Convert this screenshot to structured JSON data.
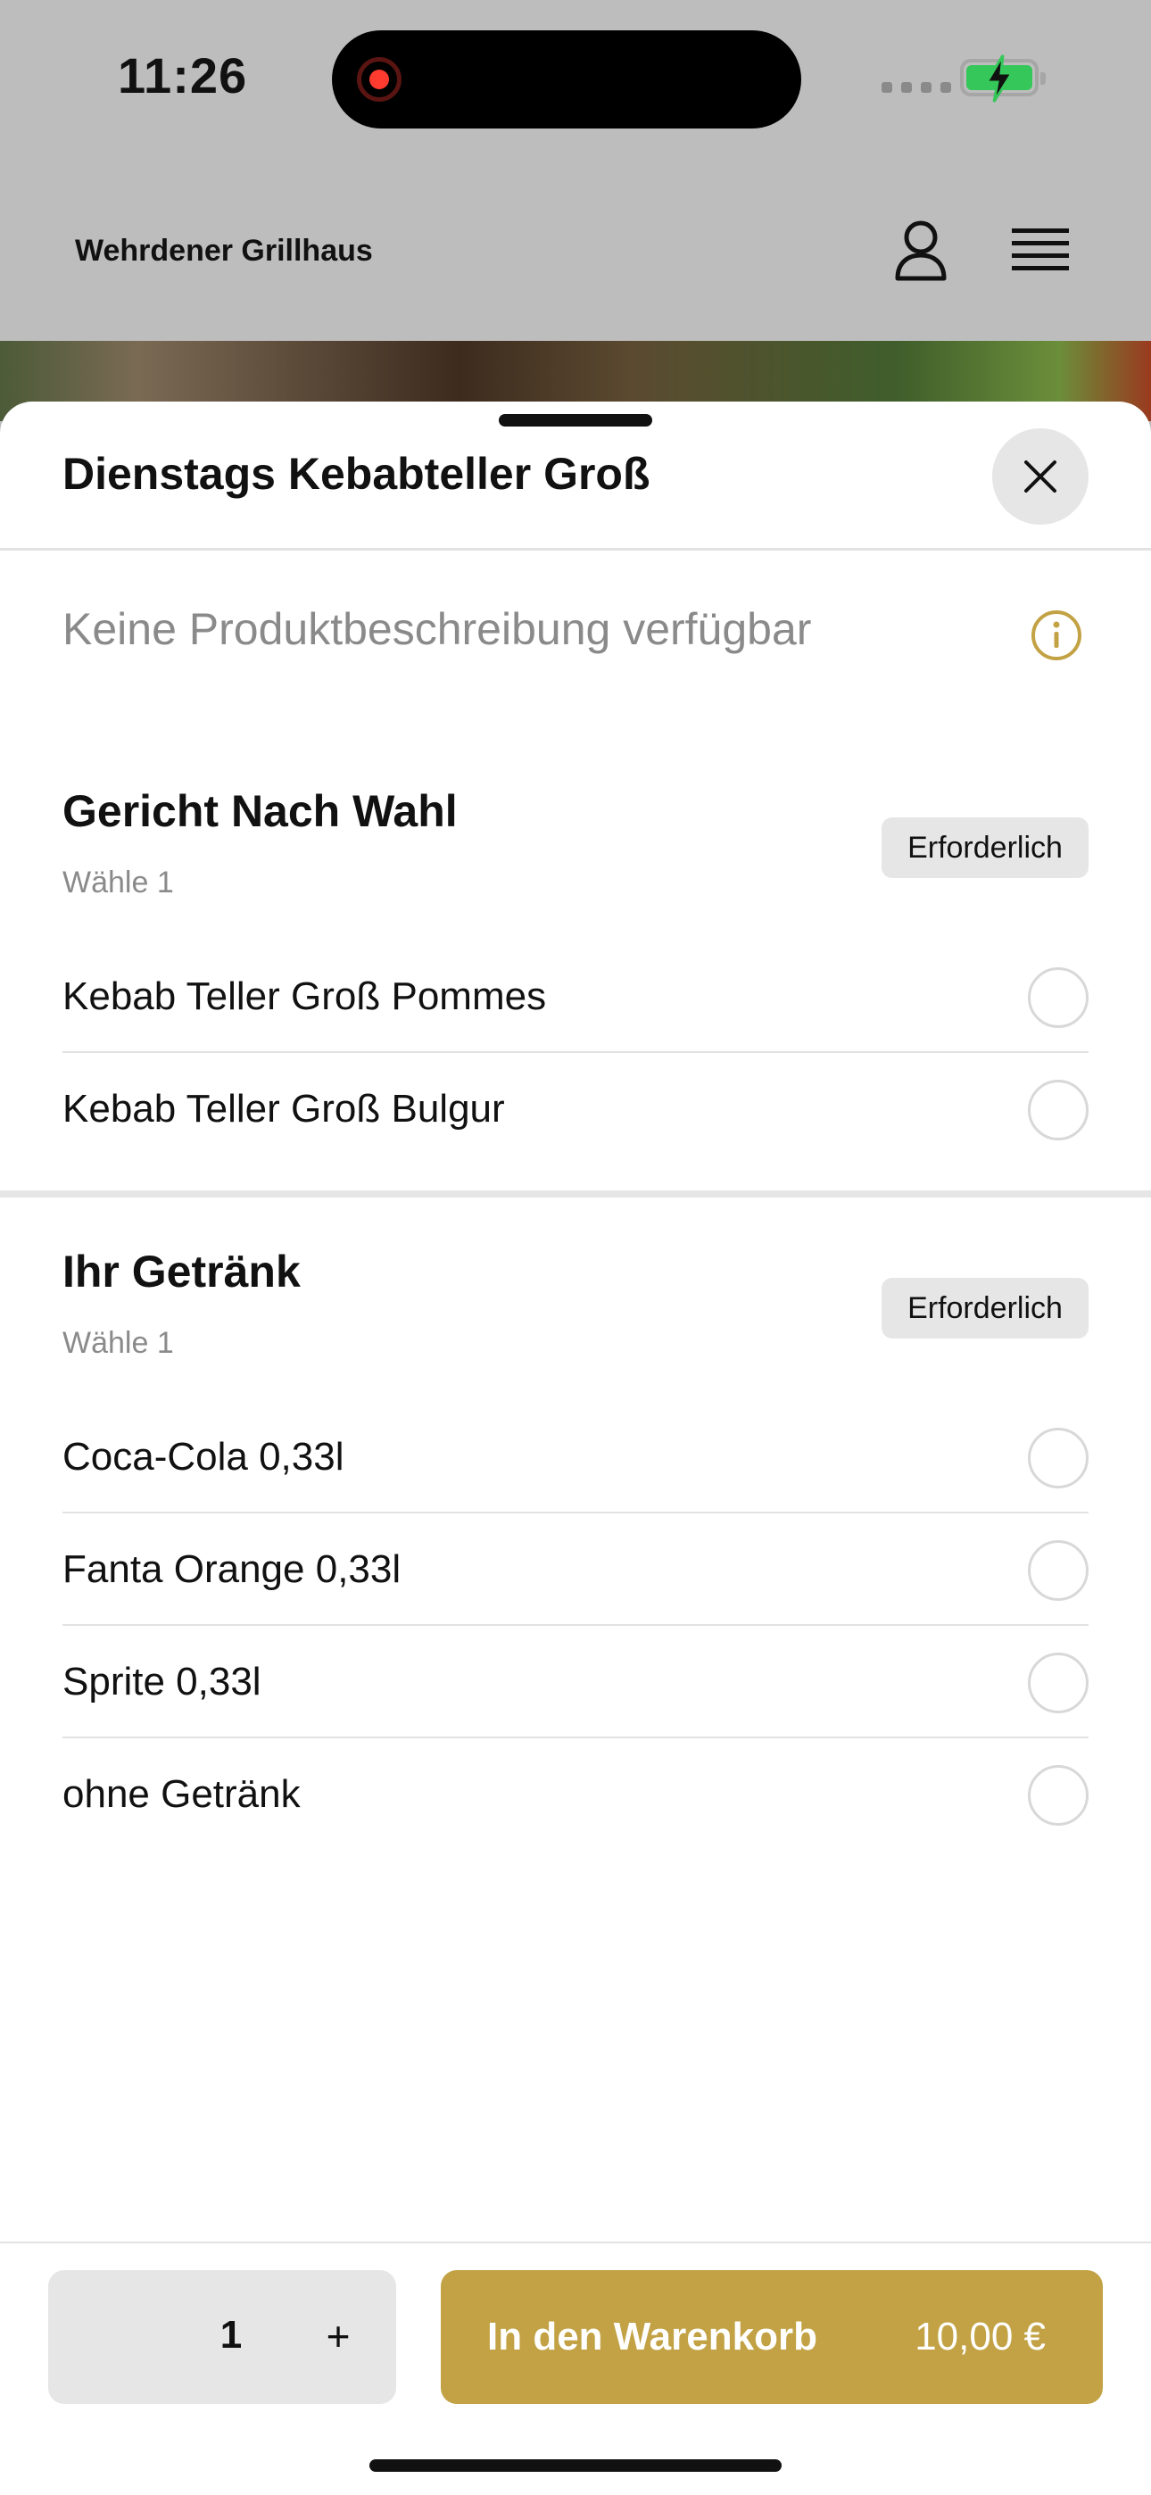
{
  "status_bar": {
    "time": "11:26"
  },
  "header": {
    "brand": "Wehrdener Grillhaus",
    "user_icon": "user-icon",
    "menu_icon": "hamburger-icon"
  },
  "sheet": {
    "title": "Dienstags Kebabteller Groß",
    "description": "Keine Produktbeschreibung verfügbar",
    "groups": [
      {
        "title": "Gericht Nach Wahl",
        "subtitle": "Wähle 1",
        "badge": "Erforderlich",
        "options": [
          {
            "label": "Kebab Teller Groß Pommes",
            "selected": false
          },
          {
            "label": "Kebab Teller Groß Bulgur",
            "selected": false
          }
        ]
      },
      {
        "title": "Ihr Getränk",
        "subtitle": "Wähle 1",
        "badge": "Erforderlich",
        "options": [
          {
            "label": "Coca-Cola 0,33l",
            "selected": false
          },
          {
            "label": "Fanta Orange 0,33l",
            "selected": false
          },
          {
            "label": "Sprite 0,33l",
            "selected": false
          },
          {
            "label": "ohne Getränk",
            "selected": false
          }
        ]
      }
    ]
  },
  "footer": {
    "quantity": "1",
    "plus": "+",
    "cart_label": "In den Warenkorb",
    "price": "10,00 €"
  },
  "colors": {
    "accent": "#c2a244",
    "backdrop": "#bdbdbd"
  }
}
